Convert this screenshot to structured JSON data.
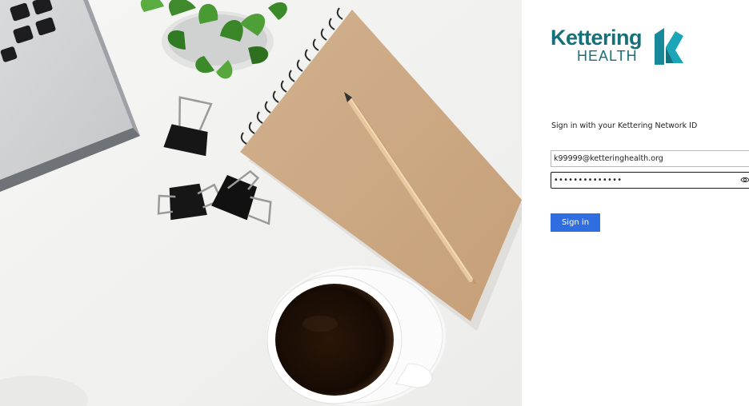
{
  "brand": {
    "name": "Kettering",
    "subname": "HEALTH",
    "color": "#16707a",
    "accent": "#1aa6b7"
  },
  "signin": {
    "prompt": "Sign in with your Kettering Network ID",
    "email_value": "k99999@ketteringhealth.org",
    "password_value": "••••••••••••••",
    "submit_label": "Sign in",
    "button_color": "#2f6ee0",
    "reveal_icon": "eye-icon"
  },
  "illustration": {
    "description_objects": [
      "laptop-corner",
      "potted-plant",
      "binder-clips",
      "spiral-notebook",
      "pencil",
      "coffee-cup"
    ]
  }
}
